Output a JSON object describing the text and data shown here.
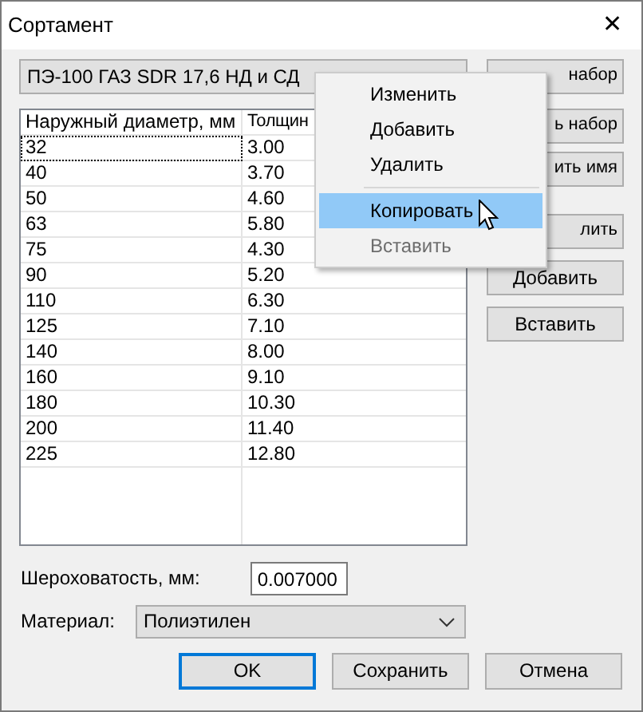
{
  "window": {
    "title": "Сортамент",
    "close": "✕"
  },
  "set_selector": {
    "value": "ПЭ-100 ГАЗ SDR 17,6 НД и СД"
  },
  "table": {
    "columns": [
      "Наружный диаметр, мм",
      "Толщин"
    ],
    "rows": [
      {
        "cells": [
          "32",
          "3.00"
        ],
        "focused": true
      },
      {
        "cells": [
          "40",
          "3.70"
        ],
        "focused": false
      },
      {
        "cells": [
          "50",
          "4.60"
        ],
        "focused": false
      },
      {
        "cells": [
          "63",
          "5.80"
        ],
        "focused": false
      },
      {
        "cells": [
          "75",
          "4.30"
        ],
        "focused": false
      },
      {
        "cells": [
          "90",
          "5.20"
        ],
        "focused": false
      },
      {
        "cells": [
          "110",
          "6.30"
        ],
        "focused": false
      },
      {
        "cells": [
          "125",
          "7.10"
        ],
        "focused": false
      },
      {
        "cells": [
          "140",
          "8.00"
        ],
        "focused": false
      },
      {
        "cells": [
          "160",
          "9.10"
        ],
        "focused": false
      },
      {
        "cells": [
          "180",
          "10.30"
        ],
        "focused": false
      },
      {
        "cells": [
          "200",
          "11.40"
        ],
        "focused": false
      },
      {
        "cells": [
          "225",
          "12.80"
        ],
        "focused": false
      }
    ]
  },
  "side_buttons": [
    "набор",
    "ь набор",
    "ить имя",
    "лить",
    "Добавить",
    "Вставить"
  ],
  "context_menu": [
    {
      "kind": "item",
      "label": "Изменить",
      "selected": false,
      "disabled": false
    },
    {
      "kind": "item",
      "label": "Добавить",
      "selected": false,
      "disabled": false
    },
    {
      "kind": "item",
      "label": "Удалить",
      "selected": false,
      "disabled": false
    },
    {
      "kind": "separator"
    },
    {
      "kind": "item",
      "label": "Копировать",
      "selected": true,
      "disabled": false
    },
    {
      "kind": "item",
      "label": "Вставить",
      "selected": false,
      "disabled": true
    }
  ],
  "roughness": {
    "label": "Шероховатость, мм:",
    "value": "0.007000"
  },
  "material": {
    "label": "Материал:",
    "value": "Полиэтилен"
  },
  "footer_buttons": [
    {
      "label": "OK",
      "default": true
    },
    {
      "label": "Сохранить",
      "default": false
    },
    {
      "label": "Отмена",
      "default": false
    }
  ]
}
